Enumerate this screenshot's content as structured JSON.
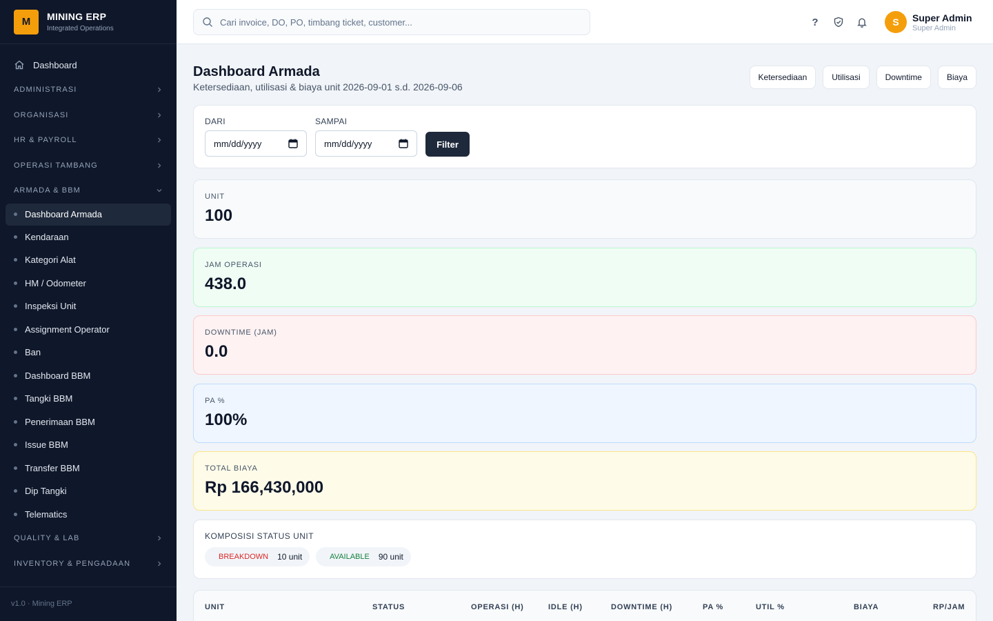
{
  "brand": {
    "logo_letter": "M",
    "title": "MINING ERP",
    "subtitle": "Integrated Operations"
  },
  "sidebar": {
    "dashboard": "Dashboard",
    "sections_top": [
      "ADMINISTRASI",
      "ORGANISASI",
      "HR & PAYROLL",
      "OPERASI TAMBANG",
      "ARMADA & BBM"
    ],
    "sub_items": [
      "Dashboard Armada",
      "Kendaraan",
      "Kategori Alat",
      "HM / Odometer",
      "Inspeksi Unit",
      "Assignment Operator",
      "Ban",
      "Dashboard BBM",
      "Tangki BBM",
      "Penerimaan BBM",
      "Issue BBM",
      "Transfer BBM",
      "Dip Tangki",
      "Telematics"
    ],
    "sections_bottom": [
      "QUALITY & LAB",
      "INVENTORY & PENGADAAN"
    ],
    "footer": "v1.0 · Mining ERP"
  },
  "topbar": {
    "search_placeholder": "Cari invoice, DO, PO, timbang ticket, customer...",
    "help_glyph": "?",
    "user_initial": "S",
    "user_name": "Super Admin",
    "user_role": "Super Admin"
  },
  "page": {
    "title": "Dashboard Armada",
    "subtitle": "Ketersediaan, utilisasi & biaya unit 2026-09-01 s.d. 2026-09-06",
    "buttons": [
      "Ketersediaan",
      "Utilisasi",
      "Downtime",
      "Biaya"
    ]
  },
  "filter": {
    "from_label": "DARI",
    "to_label": "SAMPAI",
    "from_value": "mm/dd/yyyy",
    "to_value": "mm/dd/yyyy",
    "button": "Filter"
  },
  "stats": [
    {
      "label": "UNIT",
      "value": "100",
      "tone": "gray"
    },
    {
      "label": "JAM OPERASI",
      "value": "438.0",
      "tone": "green"
    },
    {
      "label": "DOWNTIME (JAM)",
      "value": "0.0",
      "tone": "red"
    },
    {
      "label": "PA %",
      "value": "100%",
      "tone": "blue"
    },
    {
      "label": "TOTAL BIAYA",
      "value": "Rp 166,430,000",
      "tone": "yellow"
    }
  ],
  "composition": {
    "title": "KOMPOSISI STATUS UNIT",
    "chips": [
      {
        "label": "BREAKDOWN",
        "count": "10 unit",
        "color": "#dc2626"
      },
      {
        "label": "AVAILABLE",
        "count": "90 unit",
        "color": "#15803d"
      }
    ]
  },
  "table": {
    "headers": [
      "UNIT",
      "STATUS",
      "OPERASI (H)",
      "IDLE (H)",
      "DOWNTIME (H)",
      "PA %",
      "UTIL %",
      "BIAYA",
      "RP/JAM"
    ]
  },
  "colors": {
    "sidebar_bg": "#0f172a",
    "accent": "#f59e0b",
    "primary_button": "#1e293b"
  }
}
